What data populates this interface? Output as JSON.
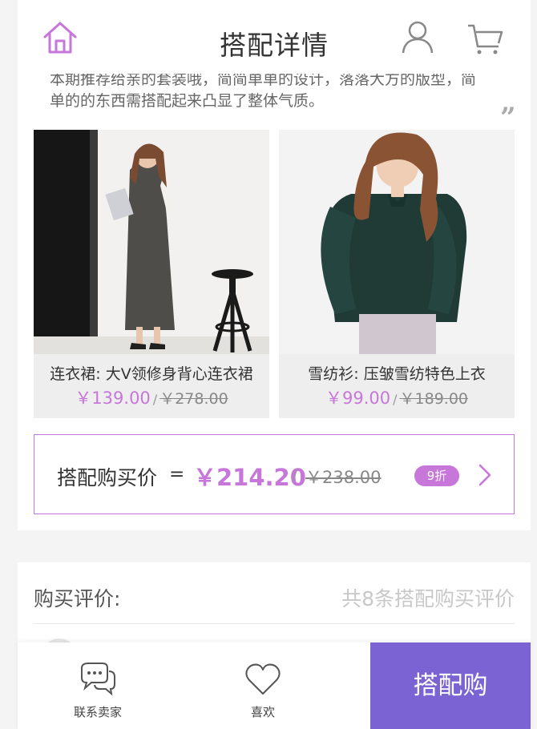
{
  "header": {
    "title": "搭配详情",
    "home_icon": "home-icon",
    "user_icon": "user-icon",
    "cart_icon": "cart-icon",
    "accent": "#c776d9"
  },
  "description": {
    "line1": "本期推荐给亲的套装哦，简简单单的设计，落落大方的版型，简",
    "line2": "单的的东西需搭配起来凸显了整体气质。",
    "quote_mark": "”"
  },
  "products": [
    {
      "name": "连衣裙: 大V领修身背心连衣裙",
      "price": "￥139.00",
      "original_price": "￥278.00",
      "slash": "/"
    },
    {
      "name": "雪纺衫: 压皱雪纺特色上衣",
      "price": "￥99.00",
      "original_price": "￥189.00",
      "slash": "/"
    }
  ],
  "bundle": {
    "label": "搭配购买价",
    "equals": "=",
    "price": "￥214.20",
    "slash": "/",
    "original_price": "￥238.00",
    "discount": "9折"
  },
  "reviews": {
    "title": "购买评价:",
    "count_text": "共8条搭配购买评价"
  },
  "bottom_bar": {
    "contact_label": "联系卖家",
    "like_label": "喜欢",
    "buy_label": "搭配购",
    "buy_color": "#7b63d3"
  }
}
